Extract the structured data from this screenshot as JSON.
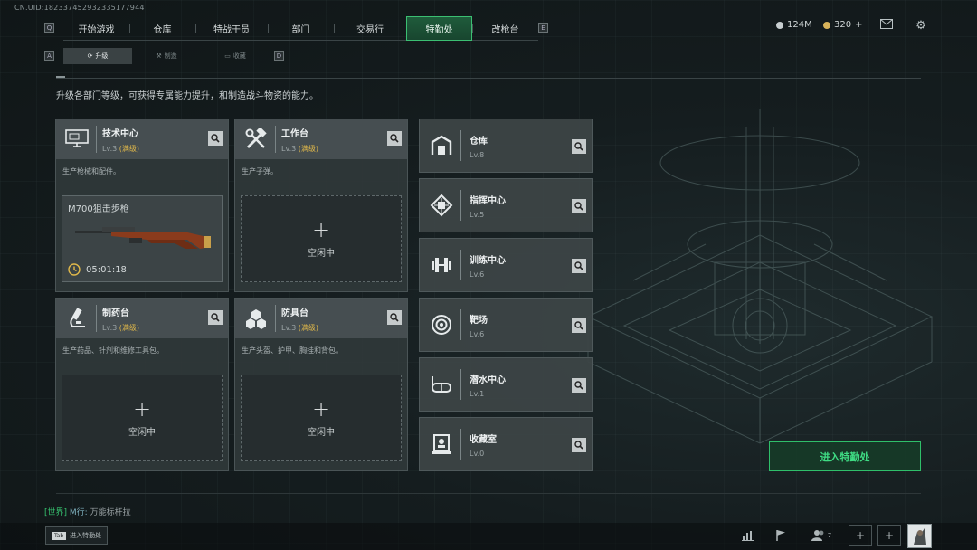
{
  "uid": "CN.UID:1823374529323351779​44",
  "nav": {
    "left_key": "Q",
    "right_key": "E",
    "tabs": [
      {
        "label": "开始游戏"
      },
      {
        "label": "仓库"
      },
      {
        "label": "特战干员"
      },
      {
        "label": "部门"
      },
      {
        "label": "交易行"
      },
      {
        "label": "特勤处"
      },
      {
        "label": "改枪台"
      }
    ],
    "active_tab": "特勤处"
  },
  "currency": {
    "silver": "124M",
    "gold": "320",
    "gold_add": "+"
  },
  "subnav": {
    "left_key": "A",
    "right_key": "D",
    "tabs": [
      {
        "label": "升级"
      },
      {
        "label": "制造"
      },
      {
        "label": "收藏"
      }
    ],
    "active_tab": "升级"
  },
  "description": "升级各部门等级，可获得专属能力提升，和制造战斗物资的能力。",
  "workshops": [
    {
      "name": "技术中心",
      "level": "Lv.3",
      "max": "(满级)",
      "desc": "生产枪械和配件。",
      "icon": "computer-icon",
      "production": {
        "item": "M700狙击步枪",
        "timer": "05:01:18"
      }
    },
    {
      "name": "工作台",
      "level": "Lv.3",
      "max": "(满级)",
      "desc": "生产子弹。",
      "icon": "tools-icon",
      "slot": "空闲中"
    },
    {
      "name": "制药台",
      "level": "Lv.3",
      "max": "(满级)",
      "desc": "生产药品、针剂和维修工具包。",
      "icon": "microscope-icon",
      "slot": "空闲中"
    },
    {
      "name": "防具台",
      "level": "Lv.3",
      "max": "(满级)",
      "desc": "生产头盔、护甲、胸挂和背包。",
      "icon": "armor-icon",
      "slot": "空闲中"
    }
  ],
  "facilities": [
    {
      "name": "仓库",
      "level": "Lv.8",
      "icon": "warehouse-icon"
    },
    {
      "name": "指挥中心",
      "level": "Lv.5",
      "icon": "chip-icon"
    },
    {
      "name": "训练中心",
      "level": "Lv.6",
      "icon": "dumbbell-icon"
    },
    {
      "name": "靶场",
      "level": "Lv.6",
      "icon": "target-icon"
    },
    {
      "name": "潜水中心",
      "level": "Lv.1",
      "icon": "diving-mask-icon"
    },
    {
      "name": "收藏室",
      "level": "Lv.0",
      "icon": "display-case-icon"
    }
  ],
  "enter_button": "进入特勤处",
  "chat": {
    "channel": "[世界]",
    "sender": "M行:",
    "message": "万能标杆拉"
  },
  "bottom": {
    "tab_key": "Tab",
    "tab_label": "进入特勤处",
    "friends_count": "7"
  },
  "colors": {
    "accent_green": "#3bbf72",
    "max_level": "#e0b84a"
  }
}
